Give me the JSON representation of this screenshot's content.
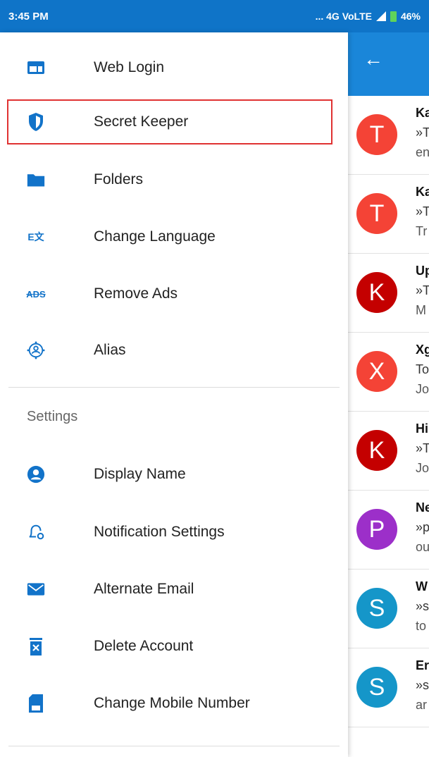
{
  "status_bar": {
    "time": "3:45 PM",
    "network": "... 4G VoLTE",
    "battery": "46%"
  },
  "drawer": {
    "items": [
      {
        "label": "Web Login",
        "icon": "web-login-icon"
      },
      {
        "label": "Secret Keeper",
        "icon": "shield-icon",
        "highlighted": true
      },
      {
        "label": "Folders",
        "icon": "folder-icon"
      },
      {
        "label": "Change Language",
        "icon": "translate-icon"
      },
      {
        "label": "Remove Ads",
        "icon": "ads-icon"
      },
      {
        "label": "Alias",
        "icon": "alias-icon"
      }
    ],
    "settings_title": "Settings",
    "settings_items": [
      {
        "label": "Display Name",
        "icon": "user-icon"
      },
      {
        "label": "Notification Settings",
        "icon": "bell-gear-icon"
      },
      {
        "label": "Alternate Email",
        "icon": "envelope-icon"
      },
      {
        "label": "Delete Account",
        "icon": "trash-icon"
      },
      {
        "label": "Change Mobile Number",
        "icon": "sim-icon"
      }
    ]
  },
  "background_list": {
    "rows": [
      {
        "initial": "T",
        "color": "#f44336",
        "line1": "Ka",
        "line2": "»T",
        "line3": "en"
      },
      {
        "initial": "T",
        "color": "#f44336",
        "line1": "Ka",
        "line2": "»T",
        "line3": "Tr"
      },
      {
        "initial": "K",
        "color": "#c40000",
        "line1": "Up",
        "line2": "»T",
        "line3": "M"
      },
      {
        "initial": "X",
        "color": "#f44336",
        "line1": "Xg",
        "line2": "To",
        "line3": "Jo"
      },
      {
        "initial": "K",
        "color": "#c40000",
        "line1": "Hi",
        "line2": "»T",
        "line3": "Jo"
      },
      {
        "initial": "P",
        "color": "#9c2fc9",
        "line1": "Ne",
        "line2": "»p",
        "line3": "ou"
      },
      {
        "initial": "S",
        "color": "#1596c9",
        "line1": "W",
        "line2": "»s",
        "line3": "to"
      },
      {
        "initial": "S",
        "color": "#1596c9",
        "line1": "Er",
        "line2": "»s",
        "line3": "ar"
      }
    ]
  },
  "colors": {
    "accent": "#1a86d9",
    "icon_blue": "#1273c9",
    "highlight_border": "#e03232"
  }
}
